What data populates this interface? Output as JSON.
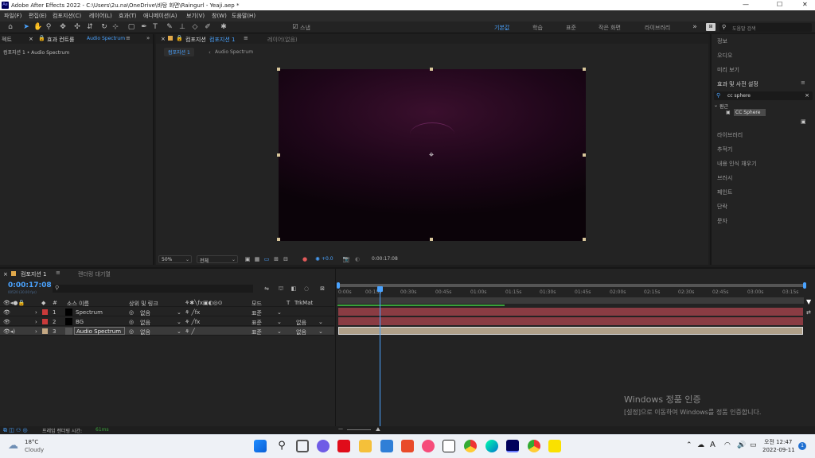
{
  "app": {
    "title": "Adobe After Effects 2022 - C:\\Users\\2u.na\\OneDrive\\바탕 화면\\Raingurl - Yeaji.aep *",
    "logo": "Ae"
  },
  "window_controls": [
    "—",
    "☐",
    "✕"
  ],
  "menu": [
    "파일(F)",
    "편집(E)",
    "컴포지션(C)",
    "레이어(L)",
    "효과(T)",
    "애니메이션(A)",
    "보기(V)",
    "창(W)",
    "도움말(H)"
  ],
  "toolbar": {
    "snap_label": "스냅",
    "workspaces": [
      "기본값",
      "학습",
      "표준",
      "작은 화면",
      "라이브러리"
    ],
    "search_placeholder": "도움말 검색"
  },
  "left_panel": {
    "tab_left": "젝트",
    "tab": "효과 컨트롤",
    "tab_layer": "Audio Spectrum",
    "breadcrumb": "컴포지션 1 • Audio Spectrum"
  },
  "comp_panel": {
    "tab": "컴포지션",
    "tab_name": "컴포지션 1",
    "tab2": "레이어(없음)",
    "sub_tab": "컴포지션 1",
    "sub_tab2": "Audio Spectrum",
    "zoom": "50%",
    "quality": "전체",
    "exposure": "+0.0",
    "timecode": "0:00:17:08"
  },
  "right_panel": {
    "items_top": [
      "정보",
      "오디오",
      "미리 보기"
    ],
    "effects_title": "효과 및 사전 설정",
    "search_value": "cc sphere",
    "folder": "원근",
    "effect": "CC Sphere",
    "items_bottom": [
      "라이브러리",
      "추적기",
      "내용 인식 채우기",
      "브러시",
      "페인트",
      "단락",
      "문자"
    ]
  },
  "timeline": {
    "tab": "컴포지션 1",
    "render_tab": "렌더링 대기열",
    "timecode": "0:00:17:08",
    "frames": "00520 (30.00 fps)",
    "columns": {
      "source": "소스 이름",
      "parent": "상위 및 링크",
      "mode": "모드",
      "t": "T",
      "trkmat": "TrkMat"
    },
    "layers": [
      {
        "num": "1",
        "name": "Spectrum",
        "parent": "없음",
        "mode": "표준",
        "trkmat": "",
        "color": "#c93a3a"
      },
      {
        "num": "2",
        "name": "BG",
        "parent": "없음",
        "mode": "표준",
        "trkmat": "없음",
        "color": "#c93a3a"
      },
      {
        "num": "3",
        "name": "Audio Spectrum",
        "parent": "없음",
        "mode": "표준",
        "trkmat": "없음",
        "color": "#c4a883"
      }
    ],
    "ticks": [
      "0:00s",
      "00:15s",
      "00:30s",
      "00:45s",
      "01:00s",
      "01:15s",
      "01:30s",
      "01:45s",
      "02:00s",
      "02:15s",
      "02:30s",
      "02:45s",
      "03:00s",
      "03:15s"
    ],
    "playhead_progress": 0.089
  },
  "status": {
    "render_label": "프레임 렌더링 시간:",
    "render_value": "61ms"
  },
  "watermark": {
    "title": "Windows 정품 인증",
    "text": "[설정]으로 이동하여 Windows를 정품 인증합니다."
  },
  "taskbar": {
    "weather_temp": "18°C",
    "weather_text": "Cloudy",
    "time": "오전 12:47",
    "date": "2022-09-11",
    "lang": "A",
    "notif": "1"
  }
}
